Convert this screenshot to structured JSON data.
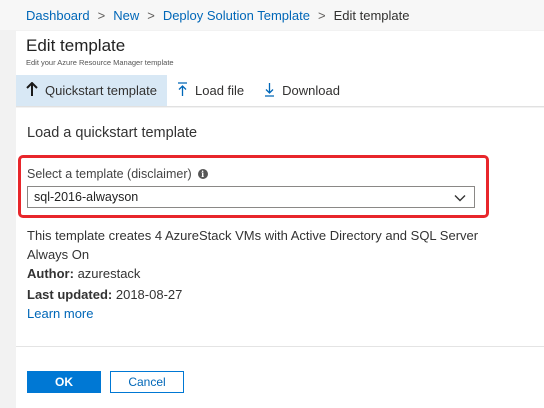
{
  "breadcrumb": {
    "items": [
      "Dashboard",
      "New",
      "Deploy Solution Template"
    ],
    "separator": ">",
    "current": "Edit template"
  },
  "header": {
    "title": "Edit template",
    "subtitle": "Edit your Azure Resource Manager template"
  },
  "toolbar": {
    "quickstart_label": "Quickstart template",
    "load_file_label": "Load file",
    "download_label": "Download",
    "active_item": "quickstart"
  },
  "main": {
    "section_title": "Load a quickstart template",
    "select_label": "Select a template (disclaimer)",
    "info_icon_glyph": "i",
    "selected_template": "sql-2016-alwayson",
    "description": "This template creates 4 AzureStack VMs with Active Directory and SQL Server Always On",
    "author_label": "Author:",
    "author_value": "azurestack",
    "updated_label": "Last updated:",
    "updated_value": "2018-08-27",
    "learn_more": "Learn more"
  },
  "footer": {
    "ok_label": "OK",
    "cancel_label": "Cancel"
  },
  "icons": {
    "quickstart": "arrow-up-icon",
    "load_file": "upload-icon",
    "download": "download-icon",
    "dropdown": "chevron-down-icon",
    "info": "info-icon"
  },
  "colors": {
    "accent": "#0078d4",
    "link": "#0067b8",
    "highlight": "#e8262b",
    "active_tab_bg": "#d8e8f5"
  }
}
